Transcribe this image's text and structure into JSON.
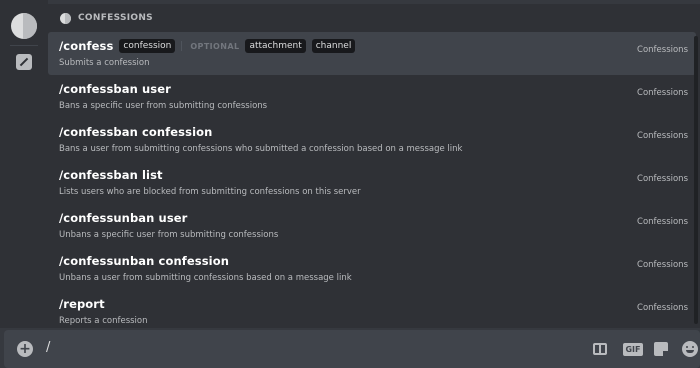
{
  "app": {
    "section_title": "CONFESSIONS"
  },
  "commands": [
    {
      "name": "/confess",
      "required_options": [
        "confession"
      ],
      "optional_label": "OPTIONAL",
      "optional_options": [
        "attachment",
        "channel"
      ],
      "description": "Submits a confession",
      "source": "Confessions",
      "selected": true
    },
    {
      "name": "/confessban user",
      "description": "Bans a specific user from submitting confessions",
      "source": "Confessions"
    },
    {
      "name": "/confessban confession",
      "description": "Bans a user from submitting confessions who submitted a confession based on a message link",
      "source": "Confessions"
    },
    {
      "name": "/confessban list",
      "description": "Lists users who are blocked from submitting confessions on this server",
      "source": "Confessions"
    },
    {
      "name": "/confessunban user",
      "description": "Unbans a specific user from submitting confessions",
      "source": "Confessions"
    },
    {
      "name": "/confessunban confession",
      "description": "Unbans a user from submitting confessions based on a message link",
      "source": "Confessions"
    },
    {
      "name": "/report",
      "description": "Reports a confession",
      "source": "Confessions"
    }
  ],
  "composer": {
    "value": "/",
    "gif_label": "GIF"
  },
  "icons": {
    "app": "confessions-app-icon",
    "slash_commands": "slash-command-icon",
    "attach": "plus-circle-icon",
    "gift": "gift-icon",
    "sticker": "sticker-icon",
    "emoji": "emoji-icon"
  },
  "colors": {
    "background": "#36393f",
    "panel": "#2f3136",
    "selected": "#40444b",
    "option_chip": "#18191c",
    "text_primary": "#ffffff",
    "text_muted": "#b9bbbe"
  }
}
